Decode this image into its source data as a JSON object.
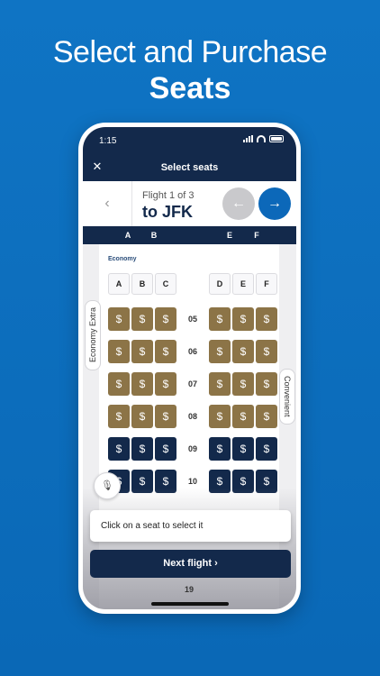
{
  "headline": {
    "line1": "Select and Purchase",
    "line2": "Seats"
  },
  "status_bar": {
    "time": "1:15"
  },
  "nav": {
    "close_label": "✕",
    "title": "Select seats"
  },
  "flight": {
    "subtitle": "Flight 1 of 3",
    "destination": "to JFK",
    "back_label": "‹",
    "prev_label": "←",
    "next_label": "→"
  },
  "column_header": [
    "A",
    "B",
    "E",
    "F"
  ],
  "cabin": {
    "label": "Economy",
    "letters": [
      "A",
      "B",
      "C",
      "D",
      "E",
      "F"
    ],
    "seat_symbol": "$",
    "rows": [
      {
        "number": "05",
        "class": "extra"
      },
      {
        "number": "06",
        "class": "extra"
      },
      {
        "number": "07",
        "class": "extra"
      },
      {
        "number": "08",
        "class": "extra"
      },
      {
        "number": "09",
        "class": "std"
      },
      {
        "number": "10",
        "class": "std"
      }
    ]
  },
  "side_tabs": {
    "left": "Economy Extra",
    "right": "Convenient"
  },
  "tooltip": "Click on a seat to select it",
  "next_button": "Next flight ›",
  "bottom_row": "19",
  "colors": {
    "navy": "#13294b",
    "gold": "#8c7447",
    "blue": "#0c68b9",
    "background": "#0f74c4"
  }
}
